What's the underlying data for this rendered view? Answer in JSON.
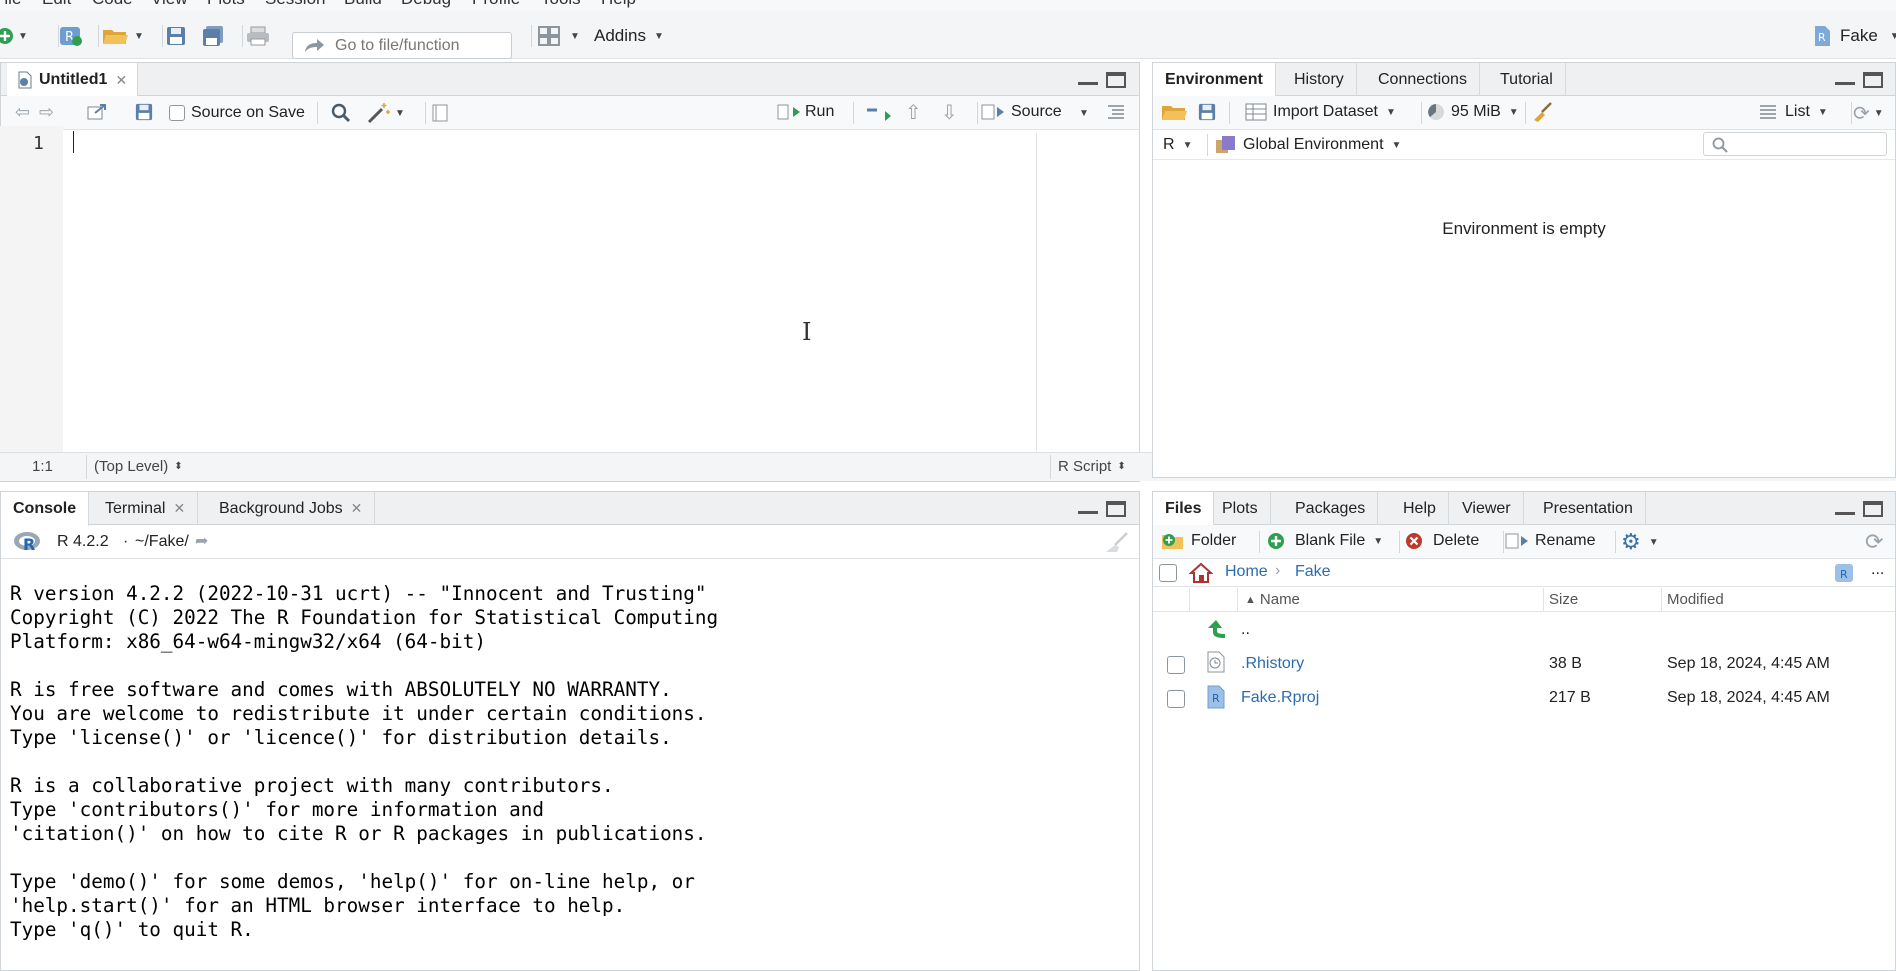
{
  "menubar": {
    "items": [
      "File",
      "Edit",
      "Code",
      "View",
      "Plots",
      "Session",
      "Build",
      "Debug",
      "Profile",
      "Tools",
      "Help"
    ]
  },
  "toolbar": {
    "goto_placeholder": "Go to file/function",
    "addins_label": "Addins",
    "project_label": "Fake"
  },
  "editor": {
    "tab_label": "Untitled1",
    "source_on_save_label": "Source on Save",
    "run_label": "Run",
    "source_label": "Source",
    "line_number": "1",
    "cursor_position": "1:1",
    "scope": "(Top Level)",
    "file_type": "R Script"
  },
  "environment": {
    "tabs": [
      "Environment",
      "History",
      "Connections",
      "Tutorial"
    ],
    "import_label": "Import Dataset",
    "memory_label": "95 MiB",
    "list_label": "List",
    "lang_label": "R",
    "scope_label": "Global Environment",
    "empty_message": "Environment is empty"
  },
  "console": {
    "tabs": [
      "Console",
      "Terminal",
      "Background Jobs"
    ],
    "version_label": "R 4.2.2",
    "dot": "·",
    "path_label": "~/Fake/",
    "lines": [
      "R version 4.2.2 (2022-10-31 ucrt) -- \"Innocent and Trusting\"",
      "Copyright (C) 2022 The R Foundation for Statistical Computing",
      "Platform: x86_64-w64-mingw32/x64 (64-bit)",
      "",
      "R is free software and comes with ABSOLUTELY NO WARRANTY.",
      "You are welcome to redistribute it under certain conditions.",
      "Type 'license()' or 'licence()' for distribution details.",
      "",
      "R is a collaborative project with many contributors.",
      "Type 'contributors()' for more information and",
      "'citation()' on how to cite R or R packages in publications.",
      "",
      "Type 'demo()' for some demos, 'help()' for on-line help, or",
      "'help.start()' for an HTML browser interface to help.",
      "Type 'q()' to quit R."
    ]
  },
  "files": {
    "tabs": [
      "Files",
      "Plots",
      "Packages",
      "Help",
      "Viewer",
      "Presentation"
    ],
    "folder_label": "Folder",
    "blank_file_label": "Blank File",
    "delete_label": "Delete",
    "rename_label": "Rename",
    "breadcrumb": [
      "Home",
      "Fake"
    ],
    "more_label": "...",
    "columns": [
      "Name",
      "Size",
      "Modified"
    ],
    "parent_dir": "..",
    "rows": [
      {
        "name": ".Rhistory",
        "size": "38 B",
        "modified": "Sep 18, 2024, 4:45 AM"
      },
      {
        "name": "Fake.Rproj",
        "size": "217 B",
        "modified": "Sep 18, 2024, 4:45 AM"
      }
    ]
  },
  "colors": {
    "accent_blue": "#2b6cb0",
    "green_icon": "#2e9f4f",
    "pane_border": "#cfd4d8"
  }
}
